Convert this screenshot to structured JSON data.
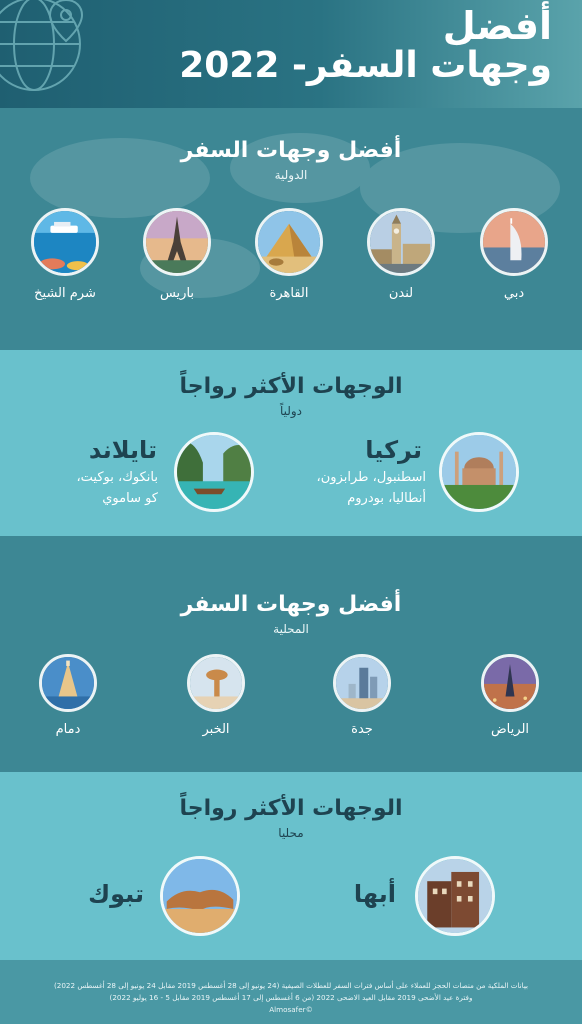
{
  "header": {
    "title_line1": "أفضل",
    "title_line2": "وجهات السفر- 2022"
  },
  "international": {
    "title": "أفضل وجهات السفر",
    "subtitle": "الدولية",
    "destinations": [
      {
        "label": "دبي",
        "icon": "burj-al-arab-photo"
      },
      {
        "label": "لندن",
        "icon": "big-ben-photo"
      },
      {
        "label": "القاهرة",
        "icon": "pyramids-photo"
      },
      {
        "label": "باريس",
        "icon": "eiffel-tower-photo"
      },
      {
        "label": "شرم الشيخ",
        "icon": "red-sea-photo"
      }
    ]
  },
  "popular_international": {
    "title": "الوجهات الأكثر رواجاً",
    "subtitle": "دولياً",
    "items": [
      {
        "name": "تركيا",
        "cities_line1": "اسطنبول، طرابزون،",
        "cities_line2": "أنطاليا، بودروم",
        "icon": "hagia-sophia-photo"
      },
      {
        "name": "تايلاند",
        "cities_line1": "بانكوك، بوكيت،",
        "cities_line2": "كو ساموي",
        "icon": "thai-beach-photo"
      }
    ]
  },
  "local": {
    "title": "أفضل وجهات السفر",
    "subtitle": "المحلية",
    "destinations": [
      {
        "label": "الرياض",
        "icon": "kingdom-tower-photo"
      },
      {
        "label": "جدة",
        "icon": "jeddah-skyline-photo"
      },
      {
        "label": "الخبر",
        "icon": "khobar-water-tower-photo"
      },
      {
        "label": "دمام",
        "icon": "dammam-landmark-photo"
      }
    ]
  },
  "popular_local": {
    "title": "الوجهات الأكثر رواجاً",
    "subtitle": "محليا",
    "items": [
      {
        "name": "أبها",
        "icon": "abha-village-photo"
      },
      {
        "name": "تبوك",
        "icon": "tabuk-rocks-photo"
      }
    ]
  },
  "footer": {
    "line1": "بيانات الملكية من منصات الحجز للعملاء على أساس فترات السفر للعطلات الصيفية (24 يونيو إلى 28 أغسطس 2019 مقابل 24 يونيو إلى 28 أغسطس 2022)",
    "line2": "وفترة عيد الأضحى 2019 مقابل العيد الاضحى 2022 (من 6 أغسطس إلى 17 أغسطس 2019 مقابل 5 - 16 يوليو 2022)",
    "line3": "©Almosafer"
  },
  "colors": {
    "header_dark": "#1f5f71",
    "section_dark": "#3d8794",
    "section_light": "#69c1cc",
    "heading_dark_text": "#1e4350"
  }
}
